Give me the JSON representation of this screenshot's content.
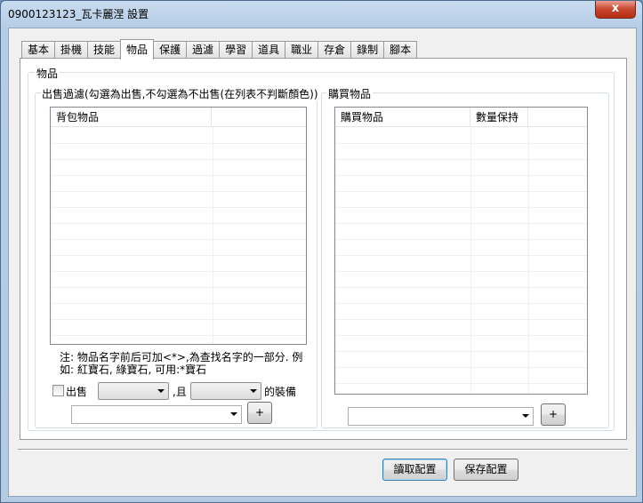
{
  "window": {
    "title": "0900123123_瓦卡麗涅  設置",
    "close_glyph": "x"
  },
  "tabs": [
    {
      "label": "基本"
    },
    {
      "label": "掛機"
    },
    {
      "label": "技能"
    },
    {
      "label": "物品"
    },
    {
      "label": "保護"
    },
    {
      "label": "過濾"
    },
    {
      "label": "學習"
    },
    {
      "label": "道具"
    },
    {
      "label": "職业"
    },
    {
      "label": "存倉"
    },
    {
      "label": "錄制"
    },
    {
      "label": "腳本"
    }
  ],
  "active_tab": "物品",
  "panel": {
    "group_title": "物品",
    "sell_group": {
      "title": "出售過濾(勾選為出售,不勾選為不出售(在列表不判斷顏色))",
      "list_headers": [
        "背包物品",
        ""
      ],
      "note_line1": "注: 物品名字前后可加<*>,為查找名字的一部分. 例",
      "note_line2": "如: 紅寶石, 綠寶石, 可用:*寶石",
      "sell_checkbox_label": "出售",
      "and_label": ",且",
      "equip_label": "的裝備",
      "add_button": "+"
    },
    "buy_group": {
      "title": "購買物品",
      "list_headers": [
        "購買物品",
        "數量保持",
        ""
      ],
      "add_button": "+"
    }
  },
  "footer": {
    "read_button": "讀取配置",
    "save_button": "保存配置"
  }
}
